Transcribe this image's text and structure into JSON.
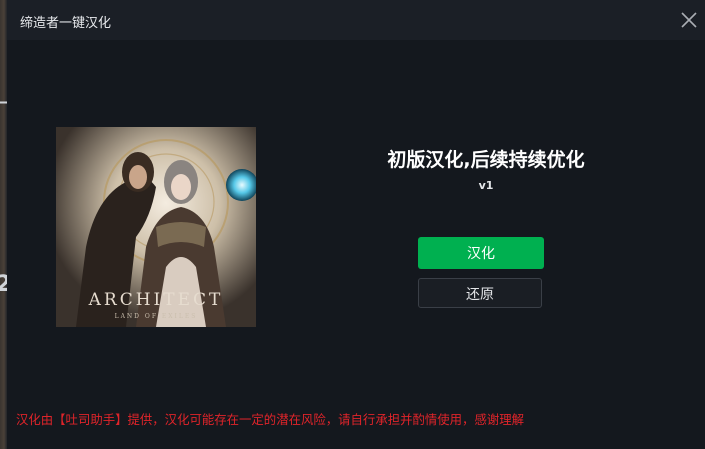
{
  "dialog": {
    "title": "缔造者一键汉化",
    "close_icon": "close-icon"
  },
  "cover": {
    "logo_text": "ARCHITECT",
    "logo_subtext": "LAND OF EXILES"
  },
  "info": {
    "headline": "初版汉化,后续持续优化",
    "version": "v1"
  },
  "actions": {
    "apply_label": "汉化",
    "restore_label": "还原"
  },
  "footer": {
    "disclaimer": "汉化由【吐司助手】提供，汉化可能存在一定的潜在风险，请自行承担并酌情使用，感谢理解"
  },
  "colors": {
    "accent_green": "#00b050",
    "warning_red": "#e0242a",
    "dialog_bg": "#14181e"
  }
}
